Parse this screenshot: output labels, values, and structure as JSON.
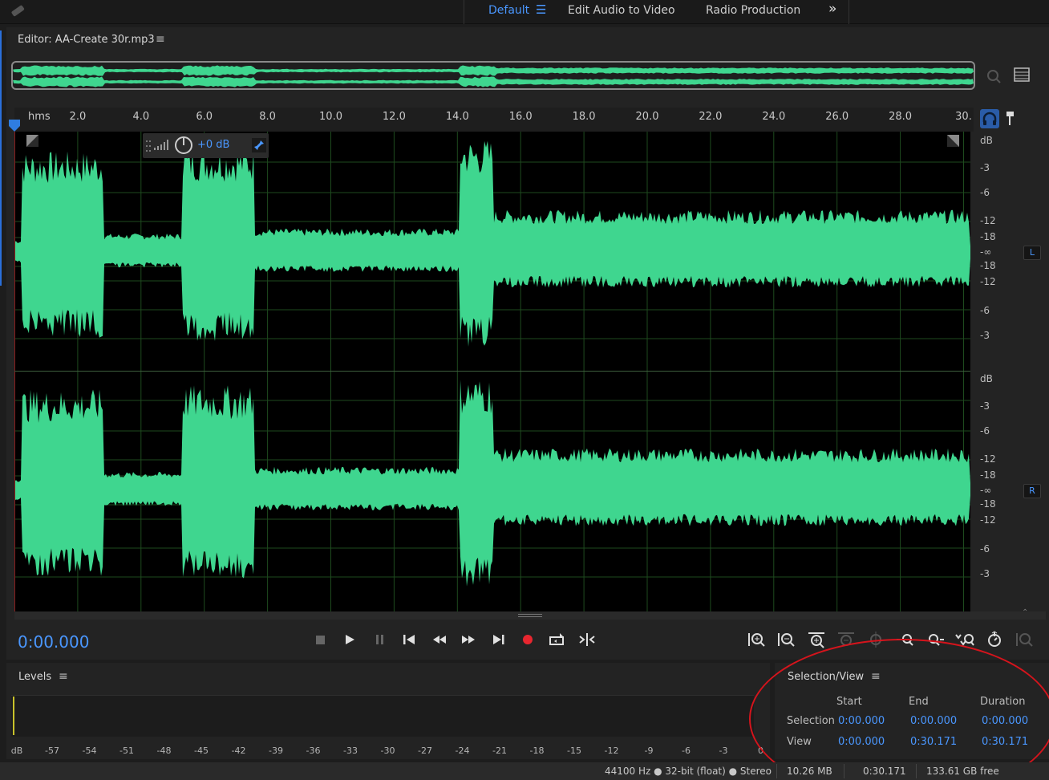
{
  "workspace": {
    "tabs": [
      {
        "label": "Default",
        "active": true
      },
      {
        "label": "Edit Audio to Video"
      },
      {
        "label": "Radio Production"
      }
    ],
    "menu_icon": "hamburger-icon",
    "more_icon": "double-chevron-right-icon",
    "more_symbol": "»"
  },
  "editor": {
    "title": "Editor: AA-Create 30r.mp3",
    "menu_symbol": "≡",
    "hud_db": "+0 dB",
    "accent_color": "#4a97ff",
    "waveform_color": "#3fd68f"
  },
  "ruler": {
    "unit": "hms",
    "ticks": [
      "2.0",
      "4.0",
      "6.0",
      "8.0",
      "10.0",
      "12.0",
      "14.0",
      "16.0",
      "18.0",
      "20.0",
      "22.0",
      "24.0",
      "26.0",
      "28.0",
      "30."
    ]
  },
  "amplitude_scale": {
    "unit": "dB",
    "labels": [
      "-3",
      "-6",
      "-12",
      "-18",
      "-∞",
      "-18",
      "-12",
      "-6",
      "-3"
    ],
    "left_channel": "L",
    "right_channel": "R"
  },
  "transport": {
    "time": "0:00.000",
    "buttons": [
      "stop-icon",
      "play-icon",
      "pause-icon",
      "go-to-start-icon",
      "rewind-icon",
      "fast-forward-icon",
      "go-to-end-icon",
      "record-icon",
      "loop-icon",
      "skip-selection-icon"
    ]
  },
  "levels": {
    "title": "Levels",
    "menu_symbol": "≡",
    "unit": "dB",
    "scale": [
      "-57",
      "-54",
      "-51",
      "-48",
      "-45",
      "-42",
      "-39",
      "-36",
      "-33",
      "-30",
      "-27",
      "-24",
      "-21",
      "-18",
      "-15",
      "-12",
      "-9",
      "-6",
      "-3",
      "0"
    ]
  },
  "selection_view": {
    "title": "Selection/View",
    "menu_symbol": "≡",
    "headers": [
      "Start",
      "End",
      "Duration"
    ],
    "rows": [
      {
        "label": "Selection",
        "start": "0:00.000",
        "end": "0:00.000",
        "duration": "0:00.000"
      },
      {
        "label": "View",
        "start": "0:00.000",
        "end": "0:30.171",
        "duration": "0:30.171"
      }
    ]
  },
  "status": {
    "format": "44100 Hz ● 32-bit (float) ● Stereo",
    "size": "10.26 MB",
    "duration": "0:30.171",
    "free": "133.61 GB free"
  }
}
